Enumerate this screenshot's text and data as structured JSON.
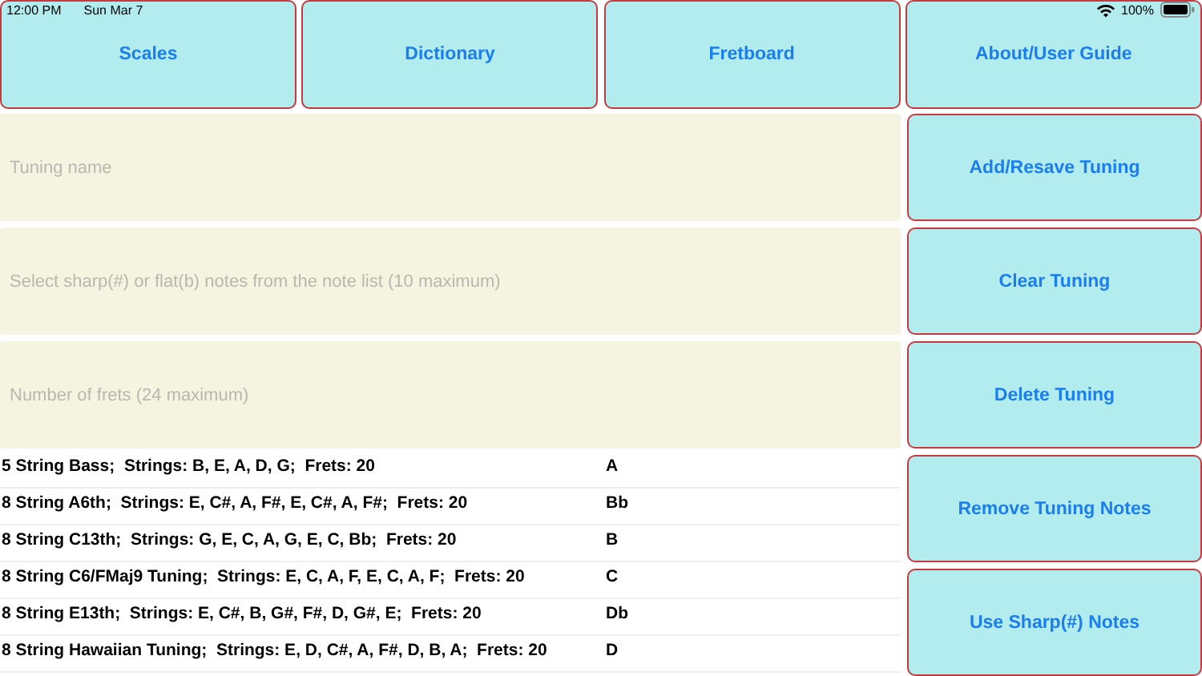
{
  "status_bar": {
    "time": "12:00 PM",
    "date": "Sun Mar 7",
    "battery": "100%"
  },
  "nav_buttons": [
    "Scales",
    "Dictionary",
    "Fretboard",
    "About/User Guide"
  ],
  "fields": [
    {
      "placeholder": "Tuning name"
    },
    {
      "placeholder": "Select sharp(#) or flat(b) notes from the note list (10 maximum)"
    },
    {
      "placeholder": "Number of frets (24 maximum)"
    }
  ],
  "tunings": [
    "5 String Bass;  Strings: B, E, A, D, G;  Frets: 20",
    "8 String A6th;  Strings: E, C#, A, F#, E, C#, A, F#;  Frets: 20",
    "8 String C13th;  Strings: G, E, C, A, G, E, C, Bb;  Frets: 20",
    "8 String C6/FMaj9 Tuning;  Strings: E, C, A, F, E, C, A, F;  Frets: 20",
    "8 String E13th;  Strings: E, C#, B, G#, F#, D, G#, E;  Frets: 20",
    "8 String Hawaiian Tuning;  Strings: E, D, C#, A, F#, D, B, A;  Frets: 20"
  ],
  "notes": [
    "A",
    "Bb",
    "B",
    "C",
    "Db",
    "D"
  ],
  "action_buttons": [
    "Add/Resave Tuning",
    "Clear Tuning",
    "Delete Tuning",
    "Remove Tuning Notes",
    "Use Sharp(#) Notes"
  ]
}
